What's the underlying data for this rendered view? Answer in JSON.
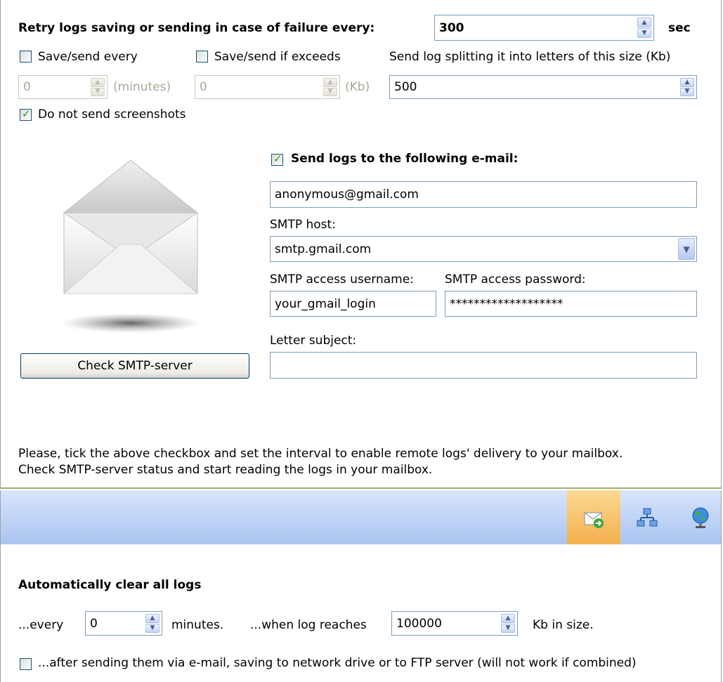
{
  "retry": {
    "label": "Retry logs saving or sending in case of failure every:",
    "value": "300",
    "unit": "sec"
  },
  "save_every": {
    "label": "Save/send every",
    "checked": false,
    "value": "0",
    "unit": "(minutes)"
  },
  "save_exceeds": {
    "label": "Save/send if exceeds",
    "checked": false,
    "value": "0",
    "unit": "(Kb)"
  },
  "split": {
    "label": "Send log splitting it into letters of this size (Kb)",
    "value": "500"
  },
  "no_screenshots": {
    "label": "Do not send screenshots",
    "checked": true
  },
  "email": {
    "send_label": "Send logs to the following e-mail:",
    "send_checked": true,
    "address": "anonymous@gmail.com",
    "smtp_host_label": "SMTP host:",
    "smtp_host": "smtp.gmail.com",
    "username_label": "SMTP access username:",
    "username": "your_gmail_login",
    "password_label": "SMTP access password:",
    "password": "*******************",
    "subject_label": "Letter subject:",
    "subject": ""
  },
  "check_button": "Check SMTP-server",
  "info": {
    "line1": "Please, tick the above checkbox and set the interval to enable remote logs' delivery to your mailbox.",
    "line2": "Check SMTP-server status and start reading the logs in your mailbox."
  },
  "toolbar": {
    "icons": [
      "email-send-icon",
      "network-drive-icon",
      "ftp-globe-icon"
    ],
    "active": "email-send-icon"
  },
  "clear": {
    "title": "Automatically clear all logs",
    "every_label": "...every",
    "every_value": "0",
    "minutes_label": "minutes.",
    "reaches_label": "...when log reaches",
    "reaches_value": "100000",
    "kb_label": "Kb in size.",
    "after_label": "...after sending them via e-mail, saving to network drive or to FTP server (will not work if combined)",
    "after_checked": false
  },
  "colors": {
    "accent": "#f3b04d",
    "toolbar": "#a9c4f0",
    "border": "#7f9db9"
  }
}
